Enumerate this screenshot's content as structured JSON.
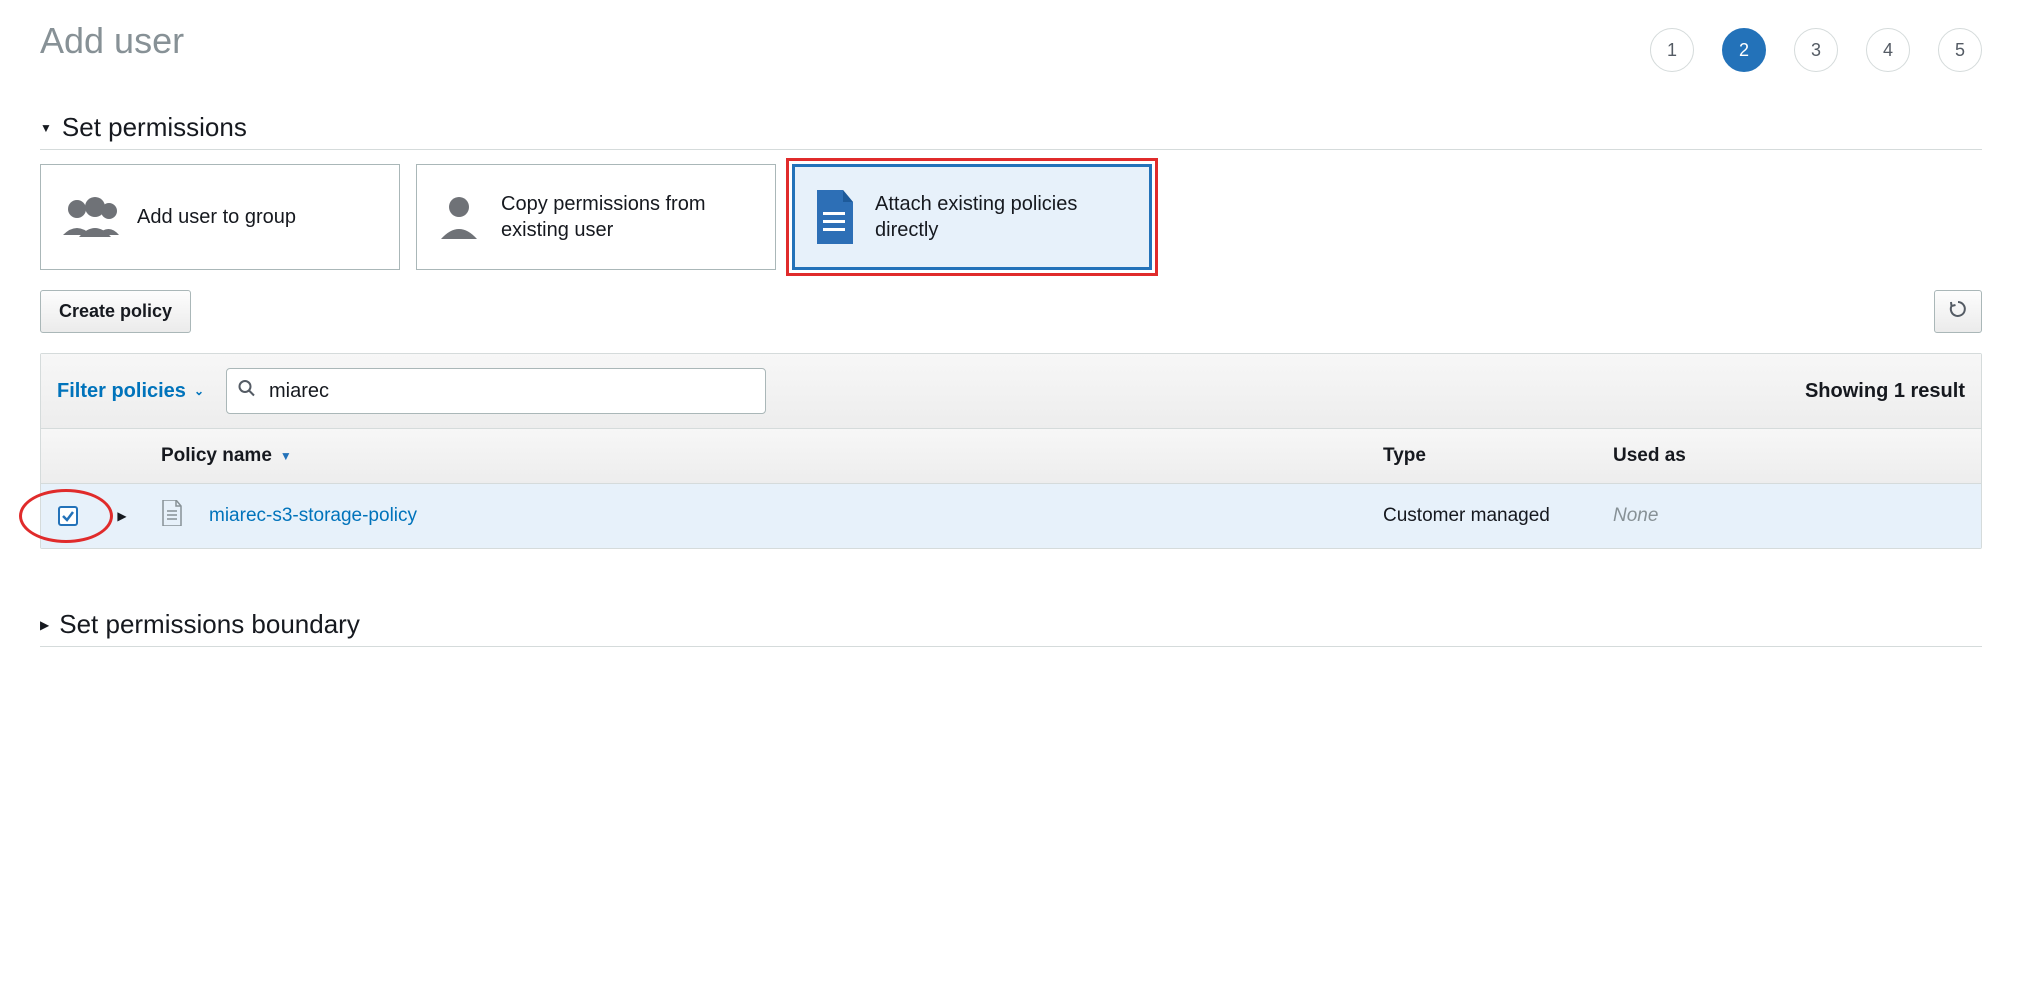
{
  "page_title": "Add user",
  "steps": [
    "1",
    "2",
    "3",
    "4",
    "5"
  ],
  "active_step": 2,
  "sections": {
    "permissions_title": "Set permissions",
    "boundary_title": "Set permissions boundary"
  },
  "perm_options": {
    "add_group": "Add user to group",
    "copy_existing": "Copy permissions from existing user",
    "attach_direct": "Attach existing policies directly"
  },
  "toolbar": {
    "create_policy": "Create policy"
  },
  "filter": {
    "filter_label": "Filter policies",
    "search_value": "miarec",
    "result_text": "Showing 1 result"
  },
  "columns": {
    "name": "Policy name",
    "type": "Type",
    "used": "Used as"
  },
  "rows": [
    {
      "checked": true,
      "name": "miarec-s3-storage-policy",
      "type": "Customer managed",
      "used": "None"
    }
  ]
}
